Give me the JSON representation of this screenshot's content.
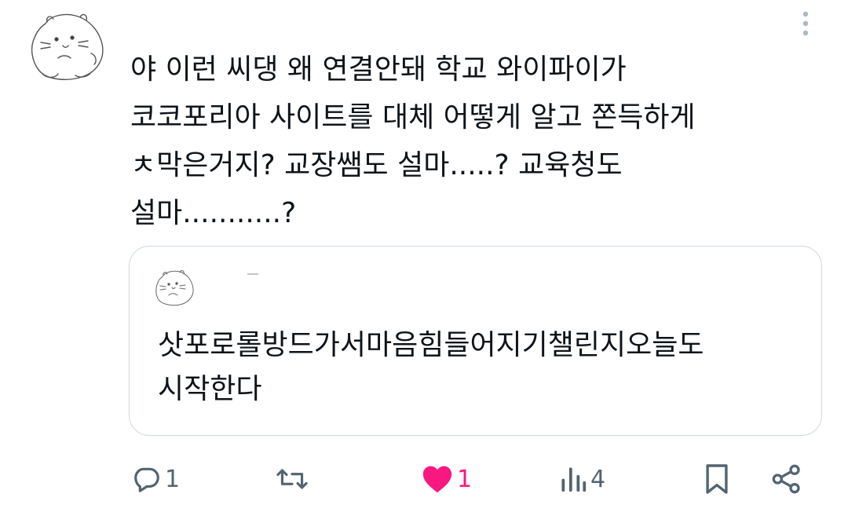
{
  "post": {
    "text_lines": [
      "야 이런 씨댕 왜 연결안돼 학교 와이파이가",
      "코코포리아 사이트를 대체 어떻게 알고 쫀득하게",
      "ㅊ막은거지? 교장쌤도 설마.....? 교육청도",
      "설마...........?"
    ]
  },
  "quote": {
    "text_lines": [
      "삿포로롤방드가서마음힘들어지기챌린지오늘도",
      "시작한다"
    ]
  },
  "actions": {
    "reply_count": "1",
    "repost_count": "",
    "like_count": "1",
    "views_count": "4"
  },
  "icons": {
    "reply": "reply-icon",
    "repost": "repost-icon",
    "like": "heart-filled-icon",
    "views": "views-icon",
    "bookmark": "bookmark-icon",
    "share": "share-icon",
    "more": "more-vertical-icon"
  },
  "colors": {
    "text": "#0f1419",
    "secondary": "#536471",
    "like": "#f91880",
    "border": "#cfd9de",
    "more_dots": "#aab8c2"
  }
}
